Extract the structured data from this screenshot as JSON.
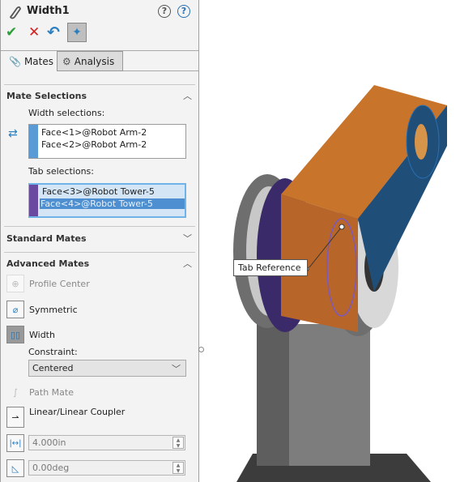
{
  "header": {
    "title": "Width1",
    "icons": [
      "paperclip-icon",
      "whats-new-help-icon",
      "help-icon"
    ]
  },
  "toolbar": {
    "ok": "ok-check-icon",
    "cancel": "cancel-x-icon",
    "undo": "undo-icon",
    "pin": "pushpin-icon"
  },
  "tabs": [
    {
      "label": "Mates",
      "active": true
    },
    {
      "label": "Analysis",
      "active": false
    }
  ],
  "mate_selections": {
    "title": "Mate Selections",
    "width_label": "Width selections:",
    "width_items": [
      "Face<1>@Robot Arm-2",
      "Face<2>@Robot Arm-2"
    ],
    "width_color": "#5b9bd5",
    "tab_label": "Tab selections:",
    "tab_items": [
      "Face<3>@Robot Tower-5",
      "Face<4>@Robot Tower-5"
    ],
    "tab_color": "#6a4aa0",
    "selected_tab_item": 1
  },
  "standard_mates": {
    "title": "Standard Mates"
  },
  "advanced_mates": {
    "title": "Advanced Mates",
    "items": {
      "profile_center": "Profile Center",
      "symmetric": "Symmetric",
      "width": "Width",
      "path_mate": "Path Mate",
      "coupler": "Linear/Linear Coupler"
    },
    "constraint_label": "Constraint:",
    "constraint_value": "Centered",
    "distance": "4.000in",
    "angle": "0.00deg"
  },
  "viewport": {
    "callout": "Tab Reference",
    "arm_color": "#c8742a",
    "face_color": "#1f4e79",
    "tower_color": "#8a8a8a"
  }
}
